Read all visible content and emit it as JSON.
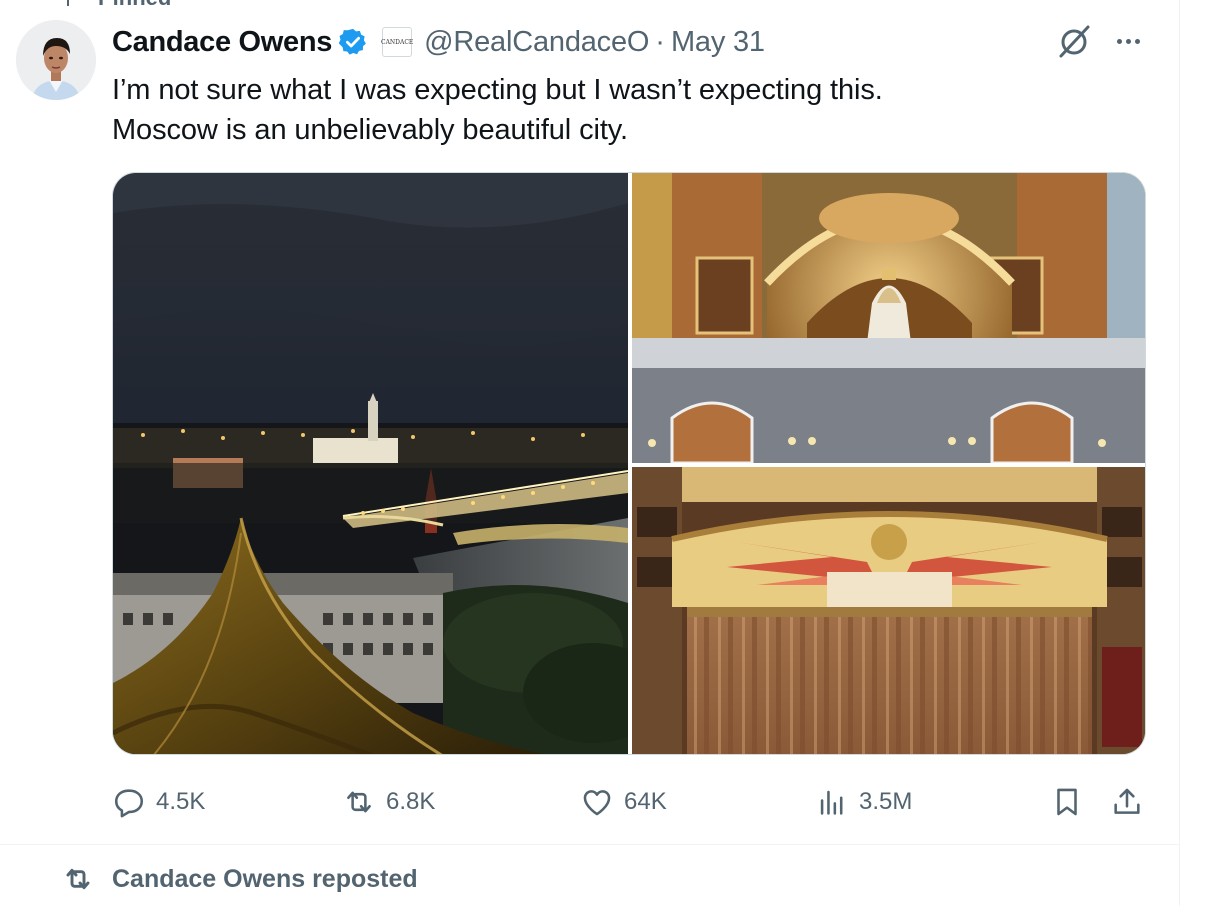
{
  "pinned": {
    "label": "Pinned"
  },
  "tweet": {
    "author_name": "Candace Owens",
    "affiliation_badge_text": "CANDACE",
    "handle": "@RealCandaceO",
    "separator": "·",
    "date": "May 31",
    "text_line1": "I’m not sure what I was expecting but I wasn’t expecting this.",
    "text_line2": "Moscow is an unbelievably beautiful city."
  },
  "actions": {
    "replies": "4.5K",
    "reposts": "6.8K",
    "likes": "64K",
    "views": "3.5M"
  },
  "next_item": {
    "repost_label": "Candace Owens reposted"
  },
  "icons": {
    "verified": "verified-badge-icon",
    "grok": "grok-icon",
    "more": "more-icon",
    "reply": "reply-icon",
    "repost": "repost-icon",
    "like": "like-icon",
    "views": "views-icon",
    "bookmark": "bookmark-icon",
    "share": "share-icon"
  },
  "colors": {
    "accent": "#1d9bf0",
    "secondary_text": "#536471",
    "primary_text": "#0f1419"
  }
}
